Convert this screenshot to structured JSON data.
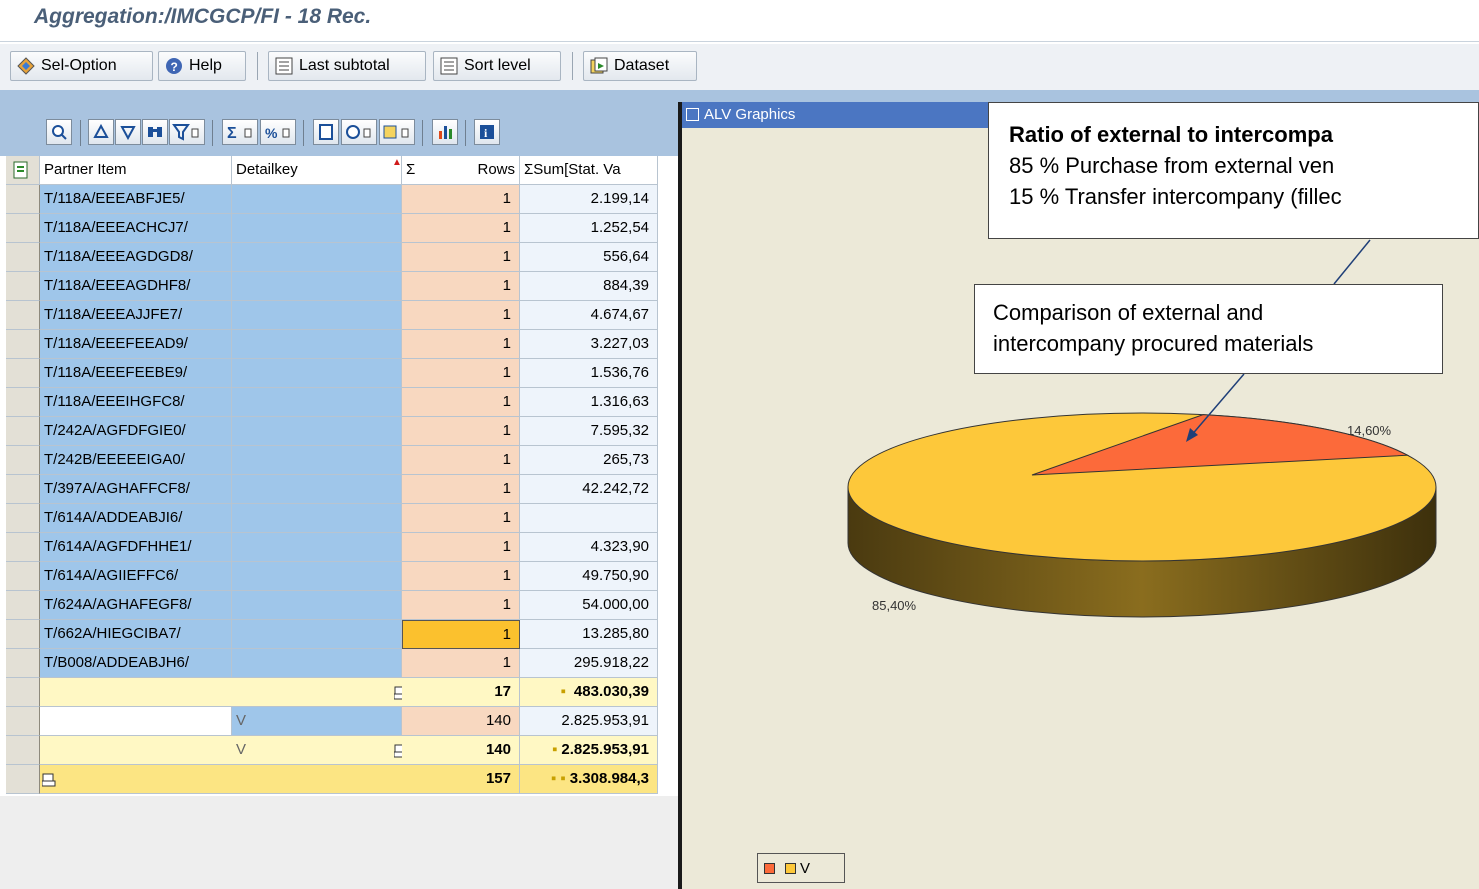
{
  "window": {
    "title": "Aggregation:/IMCGCP/FI - 18 Rec."
  },
  "toolbar": {
    "sel_option": "Sel-Option",
    "help": "Help",
    "last_subtotal": "Last subtotal",
    "sort_level": "Sort level",
    "dataset": "Dataset"
  },
  "grid": {
    "headers": {
      "partner": "Partner Item",
      "detail": "Detailkey",
      "sigma": "Σ",
      "rows": "Rows",
      "sum": "ΣSum[Stat. Va"
    },
    "rows": [
      {
        "partner": "T/118A/EEEABFJE5/",
        "rows": "1",
        "sum": "2.199,14"
      },
      {
        "partner": "T/118A/EEEACHCJ7/",
        "rows": "1",
        "sum": "1.252,54"
      },
      {
        "partner": "T/118A/EEEAGDGD8/",
        "rows": "1",
        "sum": "556,64"
      },
      {
        "partner": "T/118A/EEEAGDHF8/",
        "rows": "1",
        "sum": "884,39"
      },
      {
        "partner": "T/118A/EEEAJJFE7/",
        "rows": "1",
        "sum": "4.674,67"
      },
      {
        "partner": "T/118A/EEEFEEAD9/",
        "rows": "1",
        "sum": "3.227,03"
      },
      {
        "partner": "T/118A/EEEFEEBE9/",
        "rows": "1",
        "sum": "1.536,76"
      },
      {
        "partner": "T/118A/EEEIHGFC8/",
        "rows": "1",
        "sum": "1.316,63"
      },
      {
        "partner": "T/242A/AGFDFGIE0/",
        "rows": "1",
        "sum": "7.595,32"
      },
      {
        "partner": "T/242B/EEEEEIGA0/",
        "rows": "1",
        "sum": "265,73"
      },
      {
        "partner": "T/397A/AGHAFFCF8/",
        "rows": "1",
        "sum": "42.242,72"
      },
      {
        "partner": "T/614A/ADDEABJI6/",
        "rows": "1",
        "sum": ""
      },
      {
        "partner": "T/614A/AGFDFHHE1/",
        "rows": "1",
        "sum": "4.323,90"
      },
      {
        "partner": "T/614A/AGIIEFFC6/",
        "rows": "1",
        "sum": "49.750,90"
      },
      {
        "partner": "T/624A/AGHAFEGF8/",
        "rows": "1",
        "sum": "54.000,00"
      },
      {
        "partner": "T/662A/HIEGCIBA7/",
        "rows": "1",
        "sum": "13.285,80"
      },
      {
        "partner": "T/B008/ADDEABJH6/",
        "rows": "1",
        "sum": "295.918,22"
      }
    ],
    "subtotal1": {
      "rows": "17",
      "sum": "483.030,39"
    },
    "detail_row": {
      "detail": "V",
      "rows": "140",
      "sum": "2.825.953,91"
    },
    "subtotal2": {
      "detail": "V",
      "rows": "140",
      "sum": "2.825.953,91"
    },
    "total": {
      "rows": "157",
      "sum": "3.308.984,3"
    }
  },
  "graphics": {
    "title": "ALV Graphics",
    "callout_big": {
      "line1": "Ratio of external to intercompa",
      "line2": "85 % Purchase from external ven",
      "line3": "15 % Transfer intercompany (fillec"
    },
    "callout_small": {
      "line1": "Comparison of external and",
      "line2": "intercompany procured materials"
    },
    "legend": {
      "label": "V"
    },
    "colors": {
      "major": "#fdc83a",
      "minor": "#fc6a3a",
      "side": "#8a6d1e"
    }
  },
  "chart_data": {
    "type": "pie",
    "categories": [
      "",
      "V"
    ],
    "values": [
      14.6,
      85.4
    ],
    "labels": [
      "14,60%",
      "85,40%"
    ]
  }
}
